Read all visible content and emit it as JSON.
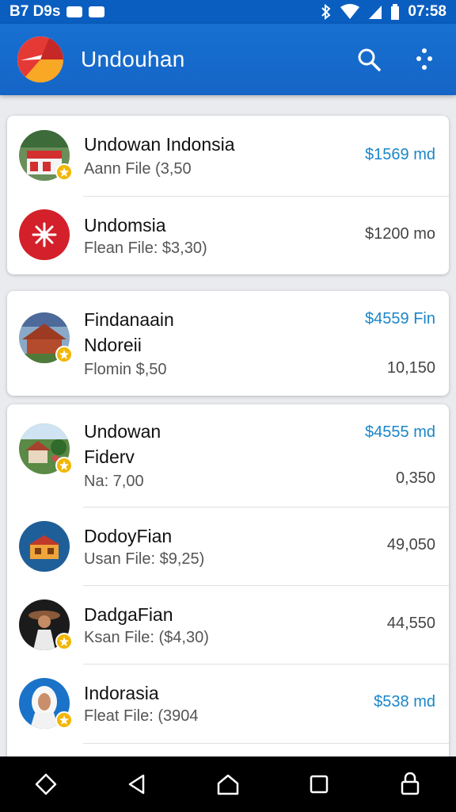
{
  "status_bar": {
    "left_text": "B7 D9s",
    "time": "07:58",
    "icons": [
      "notification-badge-icon",
      "notification-badge-icon",
      "bluetooth-icon",
      "wifi-icon",
      "signal-icon",
      "battery-icon"
    ]
  },
  "app_bar": {
    "title": "Undouhan",
    "actions": [
      "search-icon",
      "more-options-icon"
    ]
  },
  "cards": [
    {
      "items": [
        {
          "title": "Undowan Indonsia",
          "subtitle": "Aann File (3,50",
          "amount": "$1569 md",
          "amount_color": "#1a86c8",
          "avatar": "flag-photo",
          "badge": true
        },
        {
          "title": "Undomsia",
          "subtitle": "Flean File: $3,30)",
          "amount": "$1200 mo",
          "amount_color": "#444444",
          "avatar": "red-emblem",
          "badge": false
        }
      ]
    },
    {
      "items": [
        {
          "title": "Findanaain",
          "title2": "Ndoreii",
          "subtitle": "Flomin $,50",
          "amount": "$4559 Fin",
          "amount2": "10,150",
          "amount_color": "#1a86c8",
          "avatar": "temple-photo",
          "badge": true
        }
      ]
    },
    {
      "items": [
        {
          "title": "Undowan",
          "title2": "Fiderv",
          "subtitle": "Na: 7,00",
          "amount": "$4555 md",
          "amount2": "0,350",
          "amount_color": "#1a86c8",
          "avatar": "village-photo",
          "badge": true
        },
        {
          "title": "DodoyFian",
          "subtitle": "Usan File: $9,25)",
          "amount": "49,050",
          "amount_color": "#444444",
          "avatar": "house-illustration",
          "badge": false
        },
        {
          "title": "DadgaFian",
          "subtitle": "Ksan File: ($4,30)",
          "amount": "44,550",
          "amount_color": "#444444",
          "avatar": "dancer-photo",
          "badge": true
        },
        {
          "title": "Indorasia",
          "subtitle": "Fleat File: (3904",
          "amount": "$538 md",
          "amount_color": "#1a86c8",
          "avatar": "woman-photo",
          "badge": true
        }
      ]
    }
  ],
  "nav_bar": {
    "buttons": [
      "rotate-icon",
      "back-icon",
      "home-icon",
      "recents-icon",
      "lock-icon"
    ]
  }
}
